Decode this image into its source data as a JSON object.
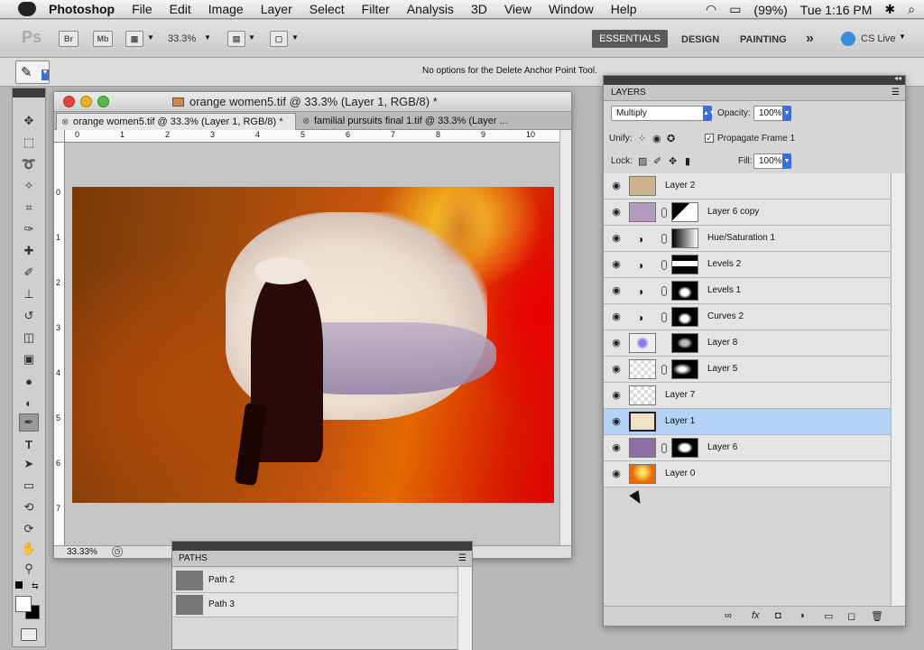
{
  "menubar": {
    "app_name": "Photoshop",
    "items": [
      "File",
      "Edit",
      "Image",
      "Layer",
      "Select",
      "Filter",
      "Analysis",
      "3D",
      "View",
      "Window",
      "Help"
    ],
    "battery": "(99%)",
    "clock": "Tue 1:16 PM"
  },
  "appbar": {
    "ps_logo": "Ps",
    "bridge_label": "Br",
    "minibridge_label": "Mb",
    "zoom_value": "33.3%",
    "workspaces": [
      "ESSENTIALS",
      "DESIGN",
      "PAINTING"
    ],
    "more_label": "»",
    "cslive_label": "CS Live"
  },
  "options": {
    "message": "No options for the Delete Anchor Point Tool."
  },
  "document": {
    "title": "orange women5.tif @ 33.3% (Layer 1, RGB/8) *",
    "tabs": [
      {
        "label": "orange women5.tif @ 33.3% (Layer 1, RGB/8) *"
      },
      {
        "label": "familial pursuits final 1.tif @ 33.3% (Layer ..."
      }
    ],
    "ruler_h": [
      "0",
      "1",
      "2",
      "3",
      "4",
      "5",
      "6",
      "7",
      "8",
      "9",
      "10"
    ],
    "ruler_v": [
      "0",
      "1",
      "2",
      "3",
      "4",
      "5",
      "6",
      "7"
    ],
    "status_zoom": "33.33%"
  },
  "layers_panel": {
    "title": "LAYERS",
    "blend_mode": "Multiply",
    "opacity_label": "Opacity:",
    "opacity_value": "100%",
    "unify_label": "Unify:",
    "propagate_label": "Propagate Frame 1",
    "lock_label": "Lock:",
    "fill_label": "Fill:",
    "fill_value": "100%",
    "layers": [
      {
        "name": "Layer 2"
      },
      {
        "name": "Layer 6 copy"
      },
      {
        "name": "Hue/Saturation 1"
      },
      {
        "name": "Levels 2"
      },
      {
        "name": "Levels 1"
      },
      {
        "name": "Curves 2"
      },
      {
        "name": "Layer 8"
      },
      {
        "name": "Layer 5"
      },
      {
        "name": "Layer 7"
      },
      {
        "name": "Layer 1"
      },
      {
        "name": "Layer 6"
      },
      {
        "name": "Layer 0"
      }
    ],
    "active_layer": "Layer 1"
  },
  "paths_panel": {
    "title": "PATHS",
    "paths": [
      {
        "name": "Path 2"
      },
      {
        "name": "Path 3"
      }
    ]
  },
  "colors": {
    "selection": "#b4d2f6",
    "accent": "#3a6fd8"
  }
}
